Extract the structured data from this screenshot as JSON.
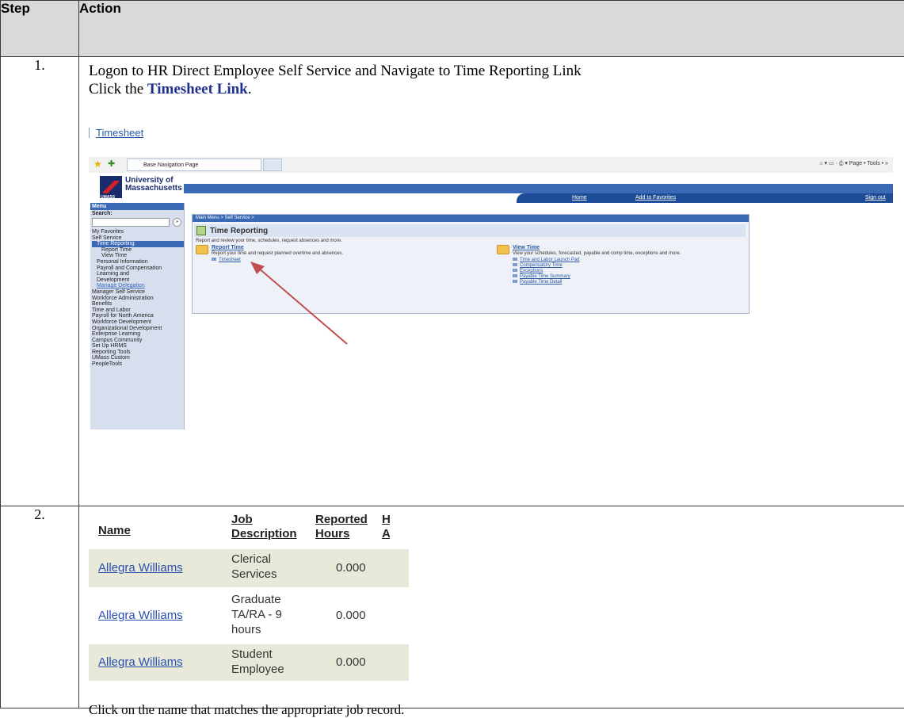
{
  "header": {
    "step": "Step",
    "action": "Action"
  },
  "row1": {
    "step": "1.",
    "line1": "Logon to HR Direct Employee Self Service and Navigate to Time Reporting Link",
    "line2_prefix": "Click the ",
    "line2_bold": "Timesheet Link",
    "line2_suffix": ".",
    "link": "Timesheet",
    "screenshot": {
      "browser_tab": "Base Navigation Page",
      "browser_tools": "Page • Tools •",
      "logo_line1": "University of",
      "logo_line2": "Massachusetts",
      "logo_mark": "UMASS",
      "nav": {
        "home": "Home",
        "favorites": "Add to Favorites",
        "signout": "Sign out"
      },
      "menu_title": "Menu",
      "search_label": "Search:",
      "menu_items": [
        "My Favorites",
        "Self Service",
        "Time Reporting",
        "Report Time",
        "View Time",
        "Personal Information",
        "Payroll and Compensation",
        "Learning and",
        "Development",
        "Manage Delegation",
        "Manager Self Service",
        "Workforce Administration",
        "Benefits",
        "Time and Labor",
        "Payroll for North America",
        "Workforce Development",
        "Organizational Development",
        "Enterprise Learning",
        "Campus Community",
        "Set Up HRMS",
        "Reporting Tools",
        "UMass Custom",
        "PeopleTools"
      ],
      "breadcrumb": "Main Menu > Self Service >",
      "page_title": "Time Reporting",
      "page_desc": "Report and review your time, schedules, request absences and more.",
      "report_title": "Report Time",
      "report_desc": "Report your time and request planned overtime and absences.",
      "report_link": "Timesheet",
      "view_title": "View Time",
      "view_desc": "View your schedules, forecasted, payable and comp time, exceptions and more.",
      "view_links": [
        "Time and Labor Launch Pad",
        "Compensatory Time",
        "Exceptions",
        "Payable Time Summary",
        "Payable Time Detail"
      ]
    }
  },
  "row2": {
    "step": "2.",
    "columns": {
      "name": "Name",
      "job1": "Job",
      "job2": "Description",
      "rep1": "Reported",
      "rep2": "Hours"
    },
    "rows": [
      {
        "name": "Allegra Williams",
        "job": [
          "Clerical",
          "Services"
        ],
        "hours": "0.000"
      },
      {
        "name": "Allegra Williams",
        "job": [
          "Graduate",
          "TA/RA - 9",
          "hours"
        ],
        "hours": "0.000"
      },
      {
        "name": "Allegra Williams",
        "job": [
          "Student",
          "Employee"
        ],
        "hours": "0.000"
      }
    ],
    "caption": "Click on the name that matches the appropriate job record."
  }
}
